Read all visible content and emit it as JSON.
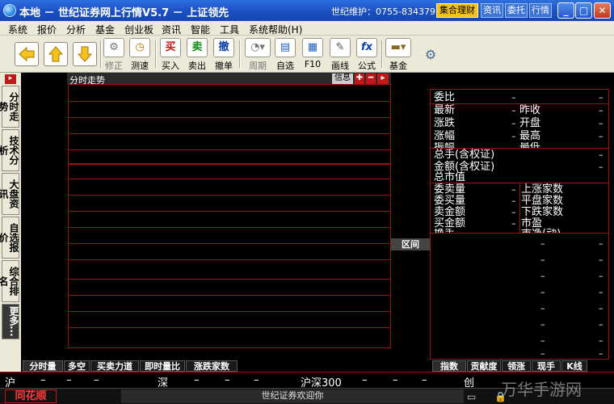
{
  "window": {
    "title": "本地 － 世纪证券网上行情V5.7 － 上证领先",
    "hotline": "世纪维护：0755-83437957",
    "top_buttons": [
      "集合理财",
      "资讯",
      "委托",
      "行情"
    ]
  },
  "menu": [
    "系统",
    "报价",
    "分析",
    "基金",
    "创业板",
    "资讯",
    "智能",
    "工具",
    "系统帮助(H)"
  ],
  "toolbar": {
    "buttons": [
      {
        "label": "修正",
        "icon": "tools-icon"
      },
      {
        "label": "测速",
        "icon": "clock-icon"
      },
      {
        "label": "买入",
        "glyph": "买"
      },
      {
        "label": "卖出",
        "glyph": "卖"
      },
      {
        "label": "撤单",
        "glyph": "撤"
      },
      {
        "label": "周期",
        "icon": "period-icon"
      },
      {
        "label": "自选",
        "icon": "folder-icon"
      },
      {
        "label": "F10",
        "icon": "document-icon"
      },
      {
        "label": "画线",
        "icon": "pencil-icon"
      },
      {
        "label": "公式",
        "glyph": "fx"
      },
      {
        "label": "基金",
        "icon": "fund-icon"
      }
    ]
  },
  "left_tabs": [
    "分时走势",
    "技术分析",
    "大盘资讯",
    "自选报价",
    "综合排名",
    "更多..."
  ],
  "chart": {
    "title": "分时走势",
    "header_button": "信息"
  },
  "range_button": "区间",
  "right_panel": {
    "rows": [
      {
        "label": "委比",
        "value": "–"
      },
      {
        "label": "最新",
        "value": "–",
        "label2": "昨收"
      },
      {
        "label": "涨跌",
        "value": "–",
        "label2": "开盘"
      },
      {
        "label": "涨幅",
        "value": "–",
        "label2": "最高"
      },
      {
        "label": "振幅",
        "value": "",
        "label2": "最低"
      },
      {
        "label": "总手(含权证)",
        "value": "–"
      },
      {
        "label": "金额(含权证)",
        "value": "–"
      },
      {
        "label": "总市值",
        "value": ""
      },
      {
        "label": "委卖量",
        "value": "–",
        "label2": "上涨家数"
      },
      {
        "label": "委买量",
        "value": "–",
        "label2": "平盘家数"
      },
      {
        "label": "卖金额",
        "value": "–",
        "label2": "下跌家数"
      },
      {
        "label": "买金额",
        "value": "–",
        "label2": "市盈"
      },
      {
        "label": "换手",
        "value": "",
        "label2": "市净(动)"
      }
    ]
  },
  "bottom_tabs_left": [
    "分时量",
    "多空",
    "买卖力道",
    "即时量比",
    "涨跌家数"
  ],
  "bottom_tabs_right": [
    "指数",
    "贡献度",
    "领涨",
    "现手",
    "K线"
  ],
  "status": {
    "sh": "沪",
    "sz": "深",
    "hs300": "沪深300",
    "cyb": "创",
    "dash": "–"
  },
  "footer": {
    "logo": "同花顺",
    "welcome": "世纪证券欢迎你"
  },
  "watermark": "万华手游网"
}
